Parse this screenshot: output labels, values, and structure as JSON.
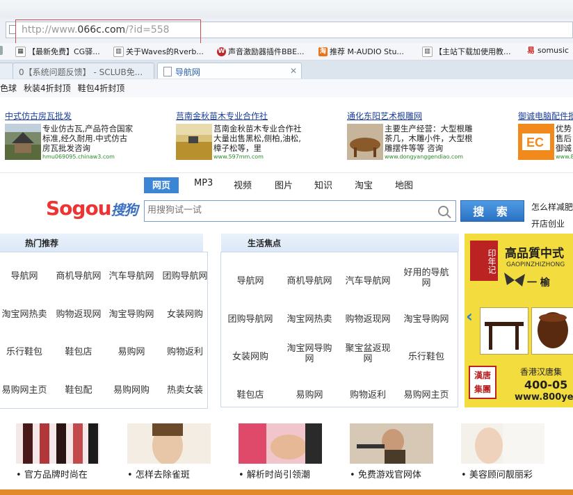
{
  "browser": {
    "url_prefix": "http://www.",
    "url_domain": "066c.com",
    "url_suffix": "/?id=558",
    "bookmarks": [
      "【最新免费】CG驿...",
      "关于Waves的Rverb...",
      "声音激励器插件BBE...",
      "推荐 M-AUDIO Stu...",
      "【主站下载加使用教...",
      "somusic"
    ],
    "tabs": [
      {
        "label": "0【系统问题反馈】 - SCLUB免...",
        "active": false
      },
      {
        "label": "导航网",
        "active": true
      }
    ],
    "tab_close": "✕"
  },
  "top_links": [
    "色球",
    "秋装4折封顶",
    "鞋包4折封顶"
  ],
  "ads": [
    {
      "title": "中式仿古房瓦批发",
      "desc": "专业仿古瓦,产品符合国家标准,经久耐用.中式仿古房瓦批发咨询",
      "url": "hmu069095.chinaw3.com"
    },
    {
      "title": "莒南金秋苗木专业合作社",
      "desc": "莒南金秋苗木专业合作社大量出售黑松,侧柏,油松,樟子松等，里",
      "url": "www.597mm.com"
    },
    {
      "title": "通化东阳艺术根雕网",
      "desc": "主要生产经营：大型根雕茶几，木雕小件，大型根雕摆件等等 咨询",
      "url": "www.dongyanggendiao.com"
    },
    {
      "title": "御诚电脑配件批",
      "desc": "优势售后御诚",
      "url": "www.8"
    }
  ],
  "search": {
    "tabs": [
      "网页",
      "MP3",
      "视频",
      "图片",
      "知识",
      "淘宝",
      "地图"
    ],
    "logo_text": "Sogou",
    "logo_cn": "搜狗",
    "placeholder": "用搜狗试一试",
    "button": "搜 索",
    "side_links": [
      "怎么样减肥",
      "开店创业"
    ]
  },
  "hot": {
    "title": "热门推荐",
    "items": [
      "导航网",
      "商机导航网",
      "汽车导航网",
      "团购导航网",
      "淘宝网热卖",
      "购物返现网",
      "淘宝导购网",
      "女装网购",
      "乐行鞋包",
      "鞋包店",
      "易购网",
      "购物返利",
      "易购网主页",
      "鞋包配",
      "易购网购",
      "热卖女装"
    ]
  },
  "life": {
    "title": "生活焦点",
    "items": [
      "导航网",
      "商机导航网",
      "汽车导航网",
      "好用的导航网",
      "团购导航网",
      "淘宝网热卖",
      "购物返现网",
      "淘宝导购网",
      "女装网购",
      "淘宝网导购网",
      "聚宝盆返现网",
      "乐行鞋包",
      "鞋包店",
      "易购网",
      "购物返利",
      "易购网主页"
    ]
  },
  "banner": {
    "headline": "高品質中式",
    "pinyin": "GAOPINZHIZHONG",
    "brand": "印年记",
    "tagline": "一 榆",
    "company": "香港汉唐集",
    "phone": "400-05",
    "site": "www.800ye",
    "seal": "漢唐集團",
    "arrow": "‹"
  },
  "bottom": [
    "官方品牌时尚在",
    "怎样去除雀斑",
    "解析时尚引领潮",
    "免费游戏官网体",
    "美容顾问靓丽彩"
  ],
  "colors": {
    "link": "#1a3f9c",
    "accent": "#3a86d4",
    "banner": "#f3dc3e"
  }
}
